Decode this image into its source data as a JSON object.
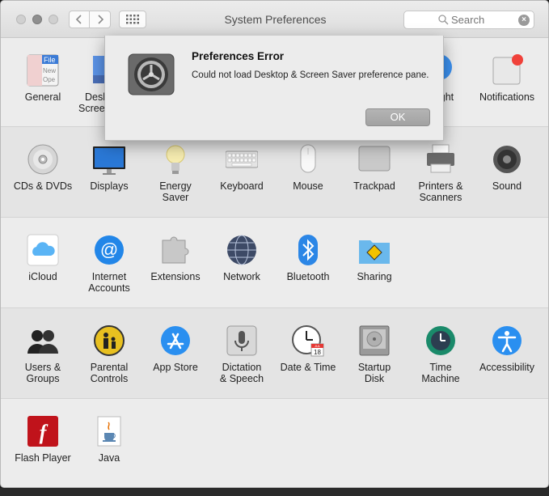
{
  "window": {
    "title": "System Preferences",
    "search_placeholder": "Search"
  },
  "dialog": {
    "title": "Preferences Error",
    "message": "Could not load Desktop & Screen Saver preference pane.",
    "ok_label": "OK",
    "icon": "system-preferences-gear-icon"
  },
  "row1": [
    {
      "label": "General",
      "icon": "general-icon"
    },
    {
      "label": "Desktop & Screen Saver",
      "icon": "desktop-icon"
    },
    {
      "label": "Spotlight",
      "icon": "spotlight-icon"
    },
    {
      "label": "Notifications",
      "icon": "notifications-icon"
    }
  ],
  "row1_partial": {
    "desk_line1": "Desk",
    "desk_line2": "Scree",
    "spot_tail": "ight"
  },
  "row2": [
    {
      "label": "CDs & DVDs",
      "icon": "cd-icon"
    },
    {
      "label": "Displays",
      "icon": "display-icon"
    },
    {
      "label": "Energy Saver",
      "icon": "lightbulb-icon"
    },
    {
      "label": "Keyboard",
      "icon": "keyboard-icon"
    },
    {
      "label": "Mouse",
      "icon": "mouse-icon"
    },
    {
      "label": "Trackpad",
      "icon": "trackpad-icon"
    },
    {
      "label": "Printers & Scanners",
      "icon": "printer-icon"
    },
    {
      "label": "Sound",
      "icon": "speaker-icon"
    }
  ],
  "row3": [
    {
      "label": "iCloud",
      "icon": "icloud-icon"
    },
    {
      "label": "Internet Accounts",
      "icon": "at-sign-icon"
    },
    {
      "label": "Extensions",
      "icon": "puzzle-icon"
    },
    {
      "label": "Network",
      "icon": "globe-icon"
    },
    {
      "label": "Bluetooth",
      "icon": "bluetooth-icon"
    },
    {
      "label": "Sharing",
      "icon": "sharing-folder-icon"
    }
  ],
  "row4": [
    {
      "label": "Users & Groups",
      "icon": "users-icon"
    },
    {
      "label": "Parental Controls",
      "icon": "parental-icon"
    },
    {
      "label": "App Store",
      "icon": "app-store-icon"
    },
    {
      "label": "Dictation & Speech",
      "icon": "microphone-icon"
    },
    {
      "label": "Date & Time",
      "icon": "clock-icon"
    },
    {
      "label": "Startup Disk",
      "icon": "disk-icon"
    },
    {
      "label": "Time Machine",
      "icon": "time-machine-icon"
    },
    {
      "label": "Accessibility",
      "icon": "accessibility-icon"
    }
  ],
  "row5": [
    {
      "label": "Flash Player",
      "icon": "flash-icon"
    },
    {
      "label": "Java",
      "icon": "java-icon"
    }
  ],
  "labels": {
    "general": "General",
    "notifications": "Notifications",
    "cds_l1": "CDs & DVDs",
    "displays": "Displays",
    "energy_l1": "Energy",
    "energy_l2": "Saver",
    "keyboard": "Keyboard",
    "mouse": "Mouse",
    "trackpad": "Trackpad",
    "printers_l1": "Printers &",
    "printers_l2": "Scanners",
    "sound": "Sound",
    "icloud": "iCloud",
    "internet_l1": "Internet",
    "internet_l2": "Accounts",
    "extensions": "Extensions",
    "network": "Network",
    "bluetooth": "Bluetooth",
    "sharing": "Sharing",
    "users_l1": "Users &",
    "users_l2": "Groups",
    "parental_l1": "Parental",
    "parental_l2": "Controls",
    "appstore": "App Store",
    "dictation_l1": "Dictation",
    "dictation_l2": "& Speech",
    "datetime": "Date & Time",
    "startup_l1": "Startup",
    "startup_l2": "Disk",
    "timemachine_l1": "Time",
    "timemachine_l2": "Machine",
    "accessibility": "Accessibility",
    "flash": "Flash Player",
    "java": "Java",
    "general_file": "File",
    "general_new": "New",
    "general_ope": "Ope",
    "clock_month": "JUL",
    "clock_day": "18"
  },
  "colors": {
    "accent": "#1f8ff0",
    "badge_red": "#f0413a"
  }
}
